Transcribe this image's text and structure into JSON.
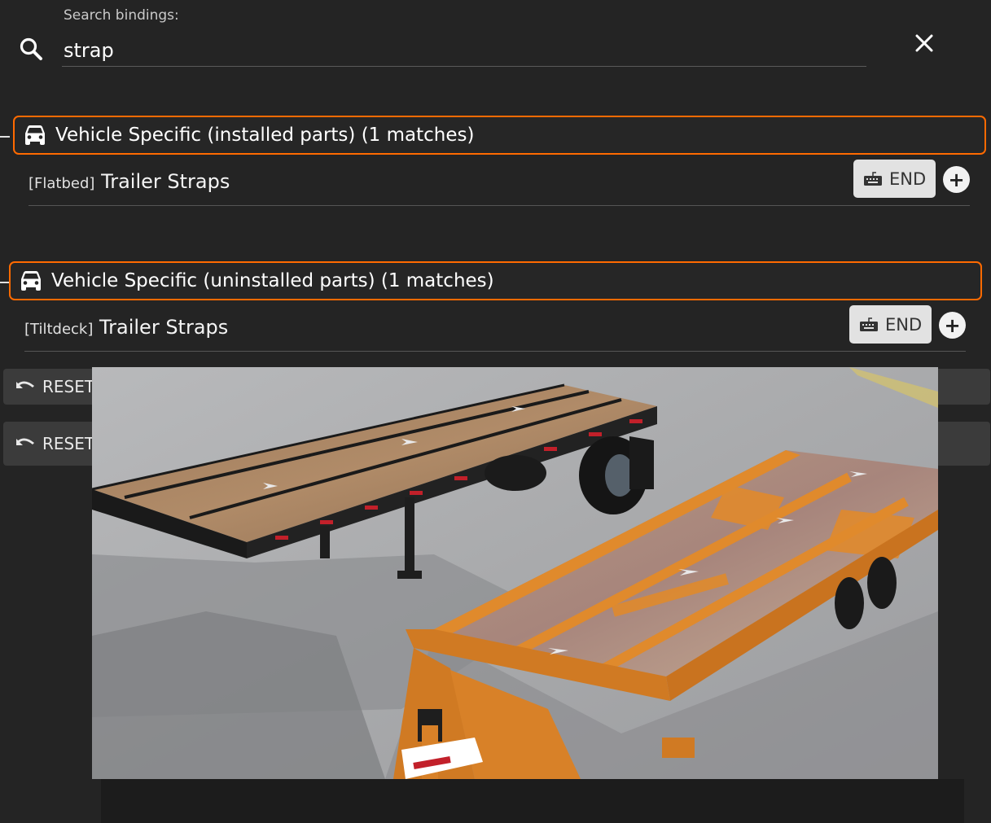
{
  "search": {
    "label": "Search bindings:",
    "value": "strap",
    "icon": "search-icon",
    "close_icon": "close-icon"
  },
  "categories": [
    {
      "title": "Vehicle Specific (installed parts) (1 matches)",
      "icon": "car-icon",
      "bindings": [
        {
          "prefix": "[Flatbed]",
          "name": "Trailer Straps",
          "key": "END"
        }
      ]
    },
    {
      "title": "Vehicle Specific (uninstalled parts) (1 matches)",
      "icon": "car-icon",
      "bindings": [
        {
          "prefix": "[Tiltdeck]",
          "name": "Trailer Straps",
          "key": "END"
        }
      ]
    }
  ],
  "actions": {
    "add_label": "+",
    "reset_label_1": "RESET",
    "reset_label_2": "RESET"
  },
  "preview": {
    "description_icon": "preview-image",
    "colors": {
      "accent_orange": "#ff6a00",
      "trailer_orange": "#e08a2c",
      "flatbed_frame": "#1a1a1a"
    }
  }
}
